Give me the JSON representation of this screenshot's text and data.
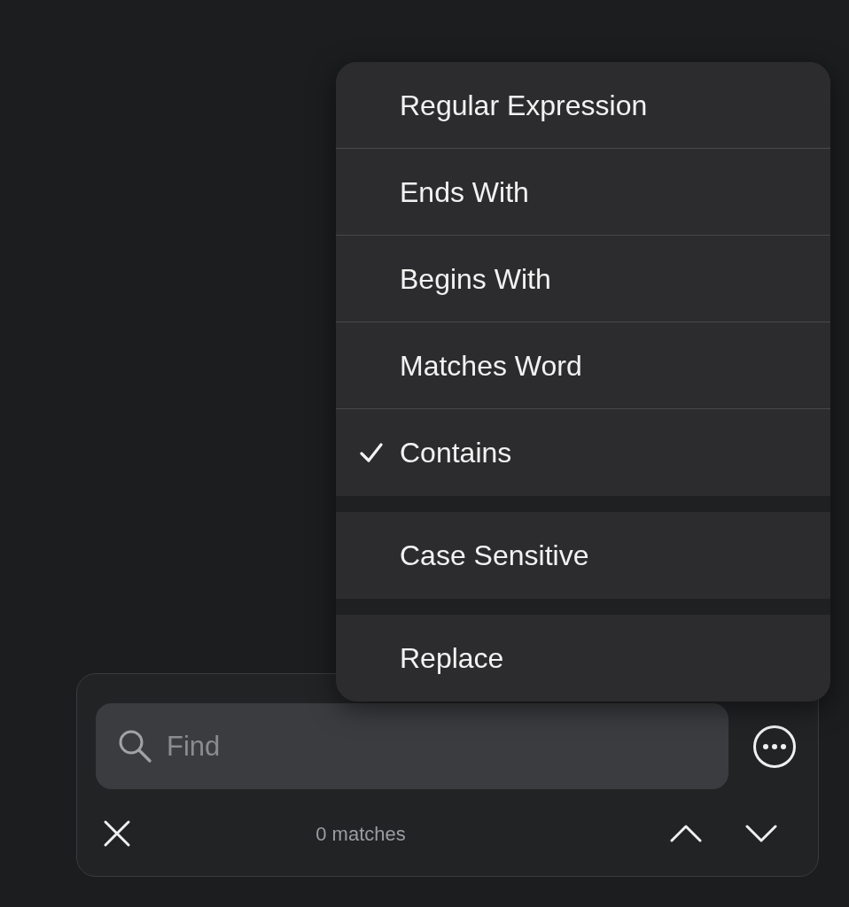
{
  "menu": {
    "groups": [
      {
        "items": [
          {
            "label": "Regular Expression",
            "checked": false
          },
          {
            "label": "Ends With",
            "checked": false
          },
          {
            "label": "Begins With",
            "checked": false
          },
          {
            "label": "Matches Word",
            "checked": false
          },
          {
            "label": "Contains",
            "checked": true
          }
        ]
      },
      {
        "items": [
          {
            "label": "Case Sensitive",
            "checked": false
          }
        ]
      },
      {
        "items": [
          {
            "label": "Replace",
            "checked": false
          }
        ]
      }
    ]
  },
  "find_panel": {
    "search": {
      "placeholder": "Find"
    },
    "status": "0 matches"
  }
}
